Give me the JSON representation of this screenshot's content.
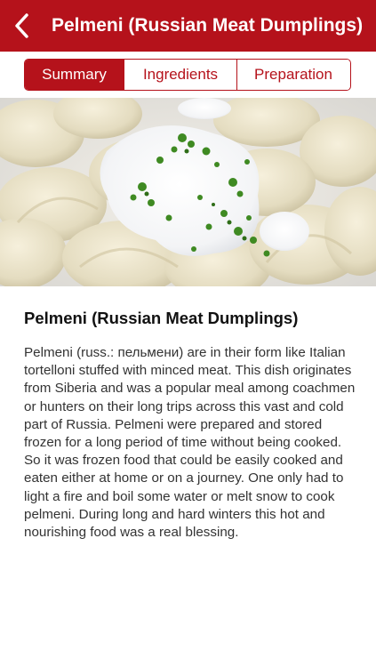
{
  "navbar": {
    "back_icon": "chevron-left-icon",
    "title": "Pelmeni (Russian Meat Dumplings)"
  },
  "tabs": [
    {
      "label": "Summary",
      "selected": true
    },
    {
      "label": "Ingredients",
      "selected": false
    },
    {
      "label": "Preparation",
      "selected": false
    }
  ],
  "hero": {
    "image": "photo of pelmeni dumplings topped with sour cream and parsley"
  },
  "recipe": {
    "title": "Pelmeni (Russian Meat Dumplings)",
    "description": "Pelmeni (russ.: пельмени) are in their form like Italian tortelloni stuffed with minced meat. This dish originates from Siberia and was a popular meal among coachmen or hunters on their long trips across this vast and cold part of Russia. Pelmeni were prepared and stored frozen for a long period of time without being cooked. So it was frozen food that could be easily cooked and eaten either at home or on a journey. One only had to light a fire and boil some water or melt snow to cook pelmeni. During long and hard winters this hot and nourishing food was a real blessing."
  },
  "colors": {
    "brand_red": "#b5121b",
    "white": "#ffffff",
    "text": "#333333"
  }
}
